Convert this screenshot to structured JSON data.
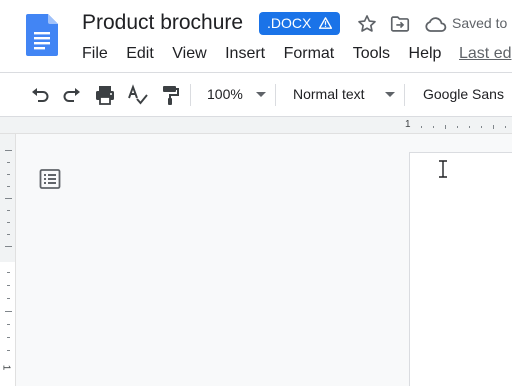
{
  "document": {
    "title": "Product brochure",
    "format_badge": ".DOCX",
    "badge_warning_icon": "warning-icon",
    "save_status": "Saved to D",
    "last_edit": "Last ed"
  },
  "menu": [
    {
      "label": "File"
    },
    {
      "label": "Edit"
    },
    {
      "label": "View"
    },
    {
      "label": "Insert"
    },
    {
      "label": "Format"
    },
    {
      "label": "Tools"
    },
    {
      "label": "Help"
    }
  ],
  "toolbar": {
    "zoom": "100%",
    "style": "Normal text",
    "font": "Google Sans",
    "icons": [
      "undo-icon",
      "redo-icon",
      "print-icon",
      "spellcheck-icon",
      "paint-format-icon"
    ]
  },
  "ruler": {
    "number": "1"
  },
  "vruler": {
    "number": "1"
  },
  "colors": {
    "accent": "#1a73e8",
    "docs_blue": "#4285f4",
    "icon_gray": "#5f6368",
    "canvas": "#f8f9fa"
  }
}
